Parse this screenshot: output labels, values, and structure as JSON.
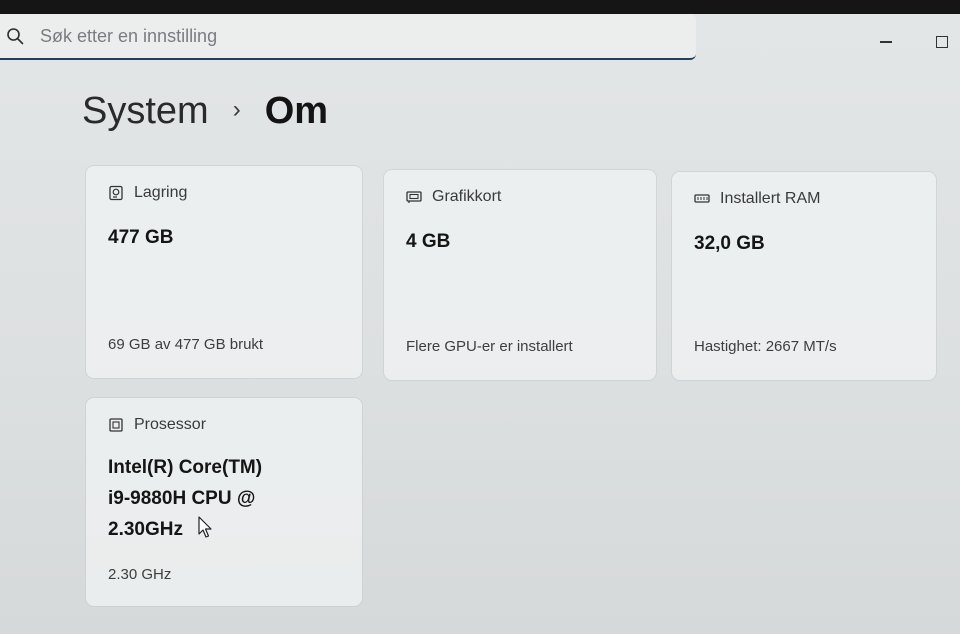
{
  "search": {
    "placeholder": "Søk etter en innstilling"
  },
  "window_controls": {
    "minimize": "minimize",
    "maximize": "maximize"
  },
  "breadcrumb": {
    "parent": "System",
    "separator": "›",
    "current": "Om"
  },
  "cards": {
    "storage": {
      "label": "Lagring",
      "icon": "storage-icon",
      "value": "477 GB",
      "detail": "69 GB av 477 GB brukt"
    },
    "graphics": {
      "label": "Grafikkort",
      "icon": "graphics-card-icon",
      "value": "4 GB",
      "detail": "Flere GPU-er er installert"
    },
    "ram": {
      "label": "Installert RAM",
      "icon": "memory-icon",
      "value": "32,0 GB",
      "detail": "Hastighet: 2667 MT/s"
    },
    "processor": {
      "label": "Prosessor",
      "icon": "processor-icon",
      "value_line1": "Intel(R) Core(TM)",
      "value_line2": "i9-9880H CPU @",
      "value_line3": "2.30GHz",
      "detail": "2.30 GHz"
    }
  },
  "colors": {
    "accent_underline": "#24405a",
    "background": "#dcdfe0",
    "card": "#f0f2f2"
  }
}
